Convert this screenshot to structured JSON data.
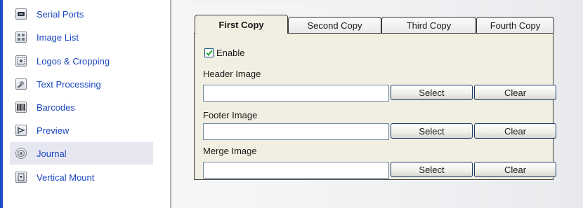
{
  "sidebar": {
    "items": [
      {
        "label": "Serial Ports",
        "icon": "serial-port-icon"
      },
      {
        "label": "Image List",
        "icon": "image-list-icon"
      },
      {
        "label": "Logos & Cropping",
        "icon": "logo-crop-icon"
      },
      {
        "label": "Text Processing",
        "icon": "text-processing-icon"
      },
      {
        "label": "Barcodes",
        "icon": "barcode-icon"
      },
      {
        "label": "Preview",
        "icon": "preview-icon"
      },
      {
        "label": "Journal",
        "icon": "journal-icon",
        "selected": true
      },
      {
        "label": "Vertical Mount",
        "icon": "vertical-mount-icon"
      }
    ],
    "accent_color": "#1e49c8",
    "link_color": "#1b47c0",
    "selected_bg": "#e7e7f1"
  },
  "tabs": [
    {
      "label": "First Copy",
      "active": true
    },
    {
      "label": "Second Copy",
      "active": false
    },
    {
      "label": "Third Copy",
      "active": false
    },
    {
      "label": "Fourth Copy",
      "active": false
    }
  ],
  "panel": {
    "enable": {
      "label": "Enable",
      "checked": true
    },
    "fields": [
      {
        "label": "Header Image",
        "value": "",
        "select_label": "Select",
        "clear_label": "Clear"
      },
      {
        "label": "Footer Image",
        "value": "",
        "select_label": "Select",
        "clear_label": "Clear"
      },
      {
        "label": "Merge Image",
        "value": "",
        "select_label": "Select",
        "clear_label": "Clear"
      }
    ],
    "background": "#f1efe1"
  }
}
